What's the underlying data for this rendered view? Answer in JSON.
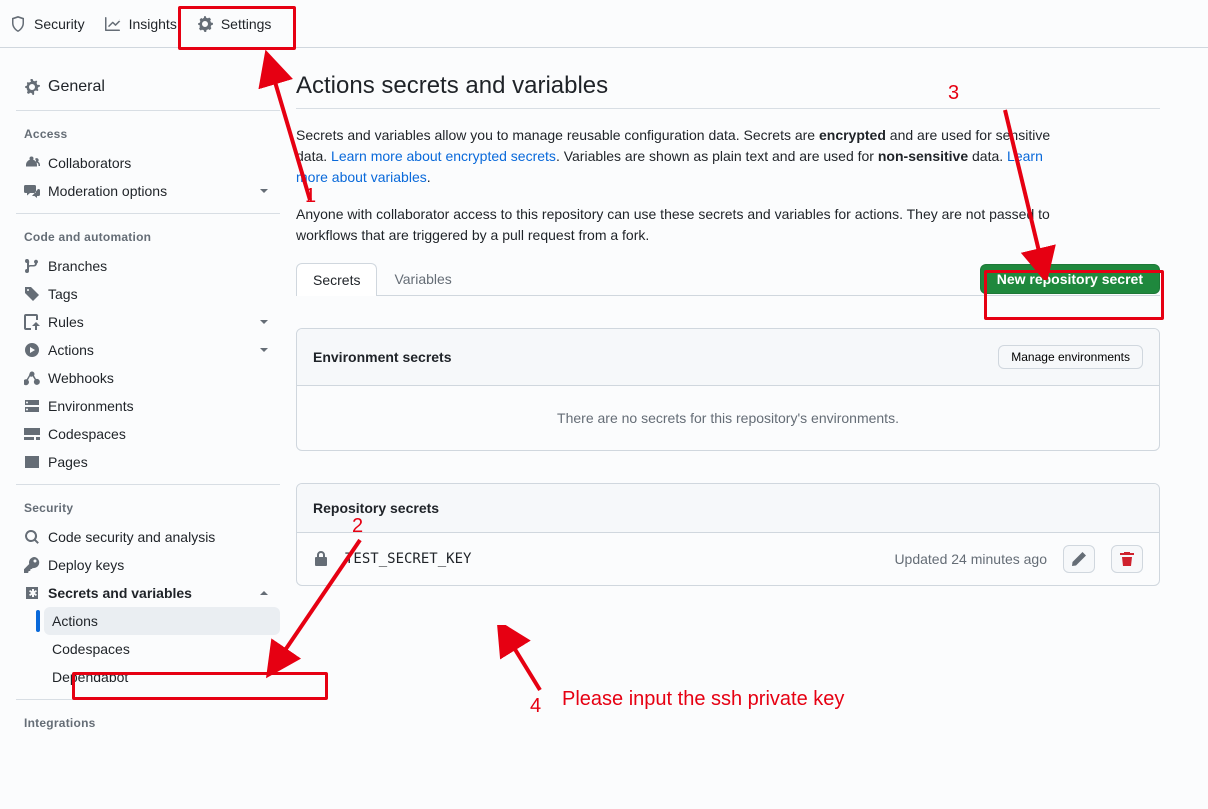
{
  "top_tabs": {
    "security": "Security",
    "insights": "Insights",
    "settings": "Settings"
  },
  "sidebar": {
    "general": "General",
    "groups": {
      "access": {
        "title": "Access",
        "collaborators": "Collaborators",
        "moderation": "Moderation options"
      },
      "code": {
        "title": "Code and automation",
        "branches": "Branches",
        "tags": "Tags",
        "rules": "Rules",
        "actions": "Actions",
        "webhooks": "Webhooks",
        "environments": "Environments",
        "codespaces": "Codespaces",
        "pages": "Pages"
      },
      "security": {
        "title": "Security",
        "code_security": "Code security and analysis",
        "deploy_keys": "Deploy keys",
        "secrets": "Secrets and variables",
        "sub": {
          "actions": "Actions",
          "codespaces": "Codespaces",
          "dependabot": "Dependabot"
        }
      },
      "integrations": {
        "title": "Integrations"
      }
    }
  },
  "page": {
    "title": "Actions secrets and variables",
    "intro1a": "Secrets and variables allow you to manage reusable configuration data. Secrets are ",
    "intro1b": "encrypted",
    "intro1c": " and are used for sensitive data. ",
    "link1": "Learn more about encrypted secrets",
    "intro1d": ". Variables are shown as plain text and are used for ",
    "intro1e": "non-sensitive",
    "intro1f": " data. ",
    "link2": "Learn more about variables",
    "intro1g": ".",
    "intro2": "Anyone with collaborator access to this repository can use these secrets and variables for actions. They are not passed to workflows that are triggered by a pull request from a fork.",
    "tabs": {
      "secrets": "Secrets",
      "variables": "Variables"
    },
    "new_secret_btn": "New repository secret",
    "env_panel": {
      "title": "Environment secrets",
      "manage_btn": "Manage environments",
      "empty": "There are no secrets for this repository's environments."
    },
    "repo_panel": {
      "title": "Repository secrets",
      "rows": [
        {
          "name": "TEST_SECRET_KEY",
          "updated": "Updated 24 minutes ago"
        }
      ]
    }
  },
  "annotations": {
    "n1": "1",
    "n2": "2",
    "n3": "3",
    "n4": "4",
    "note4": "Please input the ssh private key"
  }
}
